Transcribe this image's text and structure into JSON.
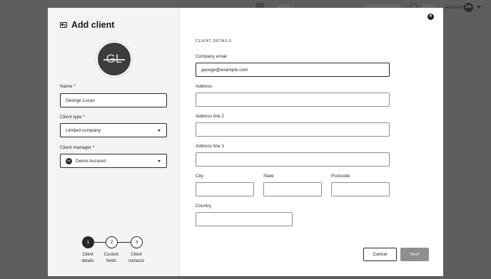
{
  "background": {
    "account_label": "Account",
    "account_initials": "DA"
  },
  "modal": {
    "title": "Add client",
    "logo_text": "GL",
    "name": {
      "label": "Name",
      "required_mark": "*",
      "value": "George Lucas"
    },
    "client_type": {
      "label": "Client type",
      "required_mark": "*",
      "value": "Limited company"
    },
    "client_manager": {
      "label": "Client manager",
      "required_mark": "*",
      "value": "Demo Account",
      "avatar_initials": "DA"
    },
    "steps": [
      {
        "number": "1",
        "label_line1": "Client",
        "label_line2": "details",
        "active": true
      },
      {
        "number": "2",
        "label_line1": "Custom",
        "label_line2": "fields",
        "active": false
      },
      {
        "number": "3",
        "label_line1": "Client",
        "label_line2": "contacts",
        "active": false
      }
    ],
    "section_title": "CLIENT DETAILS",
    "company_email": {
      "label": "Company email",
      "value": "george@example.com"
    },
    "address": {
      "label": "Address",
      "value": ""
    },
    "address_line_2": {
      "label": "Address line 2",
      "value": ""
    },
    "address_line_3": {
      "label": "Address line 3",
      "value": ""
    },
    "city": {
      "label": "City",
      "value": ""
    },
    "state": {
      "label": "State",
      "value": ""
    },
    "postcode": {
      "label": "Postcode",
      "value": ""
    },
    "country": {
      "label": "Country",
      "value": ""
    },
    "cancel_label": "Cancel",
    "next_label": "Next",
    "close_icon": "close-icon"
  },
  "colors": {
    "overlay": "#5e5e5e",
    "sidebar": "#f4f4f4",
    "active_step": "#262626",
    "disabled_button": "#8f8f8f"
  }
}
